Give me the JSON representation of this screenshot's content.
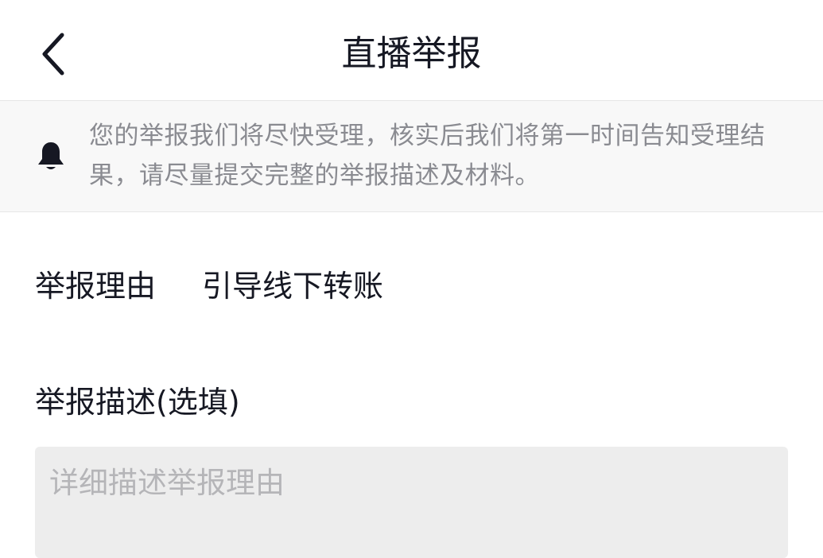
{
  "header": {
    "title": "直播举报",
    "back_icon": "chevron-left-icon"
  },
  "notice": {
    "icon": "bell-icon",
    "text": "您的举报我们将尽快受理，核实后我们将第一时间告知受理结果，请尽量提交完整的举报描述及材料。"
  },
  "form": {
    "reason_label": "举报理由",
    "reason_value": "引导线下转账",
    "description_label": "举报描述(选填)",
    "description_value": "",
    "description_placeholder": "详细描述举报理由"
  },
  "colors": {
    "text_primary": "#161823",
    "text_secondary": "#8a8b91",
    "notice_background": "#f8f8f8",
    "input_background": "#ededed",
    "placeholder": "#b5b5b8"
  }
}
